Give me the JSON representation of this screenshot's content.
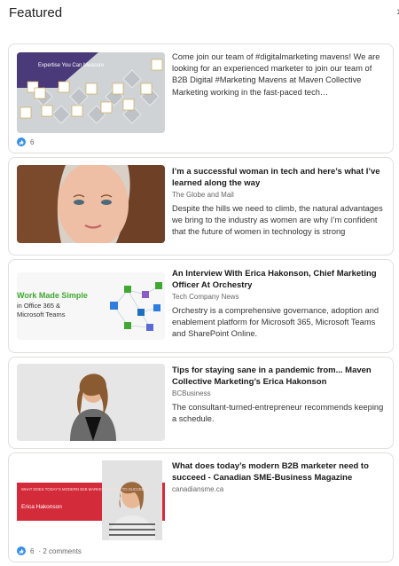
{
  "header": {
    "title": "Featured",
    "nav_icon": "chevron-right-icon"
  },
  "cards": [
    {
      "thumb": {
        "title": "Expertise You Can Measure"
      },
      "description": "Come join our team of #digitalmarketing mavens! We are looking for an experienced marketer to join our team of B2B Digital #Marketing Mavens at Maven Collective Marketing working in the fast-paced tech…",
      "reactions": "6"
    },
    {
      "title": "I’m a successful woman in tech and here’s what I’ve learned along the way",
      "source": "The Globe and Mail",
      "description": "Despite the hills we need to climb, the natural advantages we bring to the industry as women are why I’m confident that the future of women in technology is strong"
    },
    {
      "thumb": {
        "line1": "Work Made Simple",
        "line2": "in Office 365 &",
        "line3": "Microsoft Teams"
      },
      "title": "An Interview With Erica Hakonson, Chief Marketing Officer At Orchestry",
      "source": "Tech Company News",
      "description": "Orchestry is a comprehensive governance, adoption and enablement platform for Microsoft 365, Microsoft Teams and SharePoint Online."
    },
    {
      "title": "Tips for staying sane in a pandemic from... Maven Collective Marketing’s Erica Hakonson",
      "source": "BCBusiness",
      "description": "The consultant-turned-entrepreneur recommends keeping a schedule."
    },
    {
      "thumb": {
        "banner": "WHAT DOES TODAY'S MODERN B2B MARKETER NEED TO SUCCEED",
        "name": "Erica Hakonson"
      },
      "title": "What does today’s modern B2B marketer need to succeed - Canadian SME-Business Magazine",
      "source": "canadiansme.ca",
      "reactions": "6",
      "comments": "· 2 comments"
    }
  ],
  "colors": {
    "like": "#378fe9",
    "purple": "#4a3a7a",
    "red": "#d42b3a",
    "green": "#41a832"
  }
}
